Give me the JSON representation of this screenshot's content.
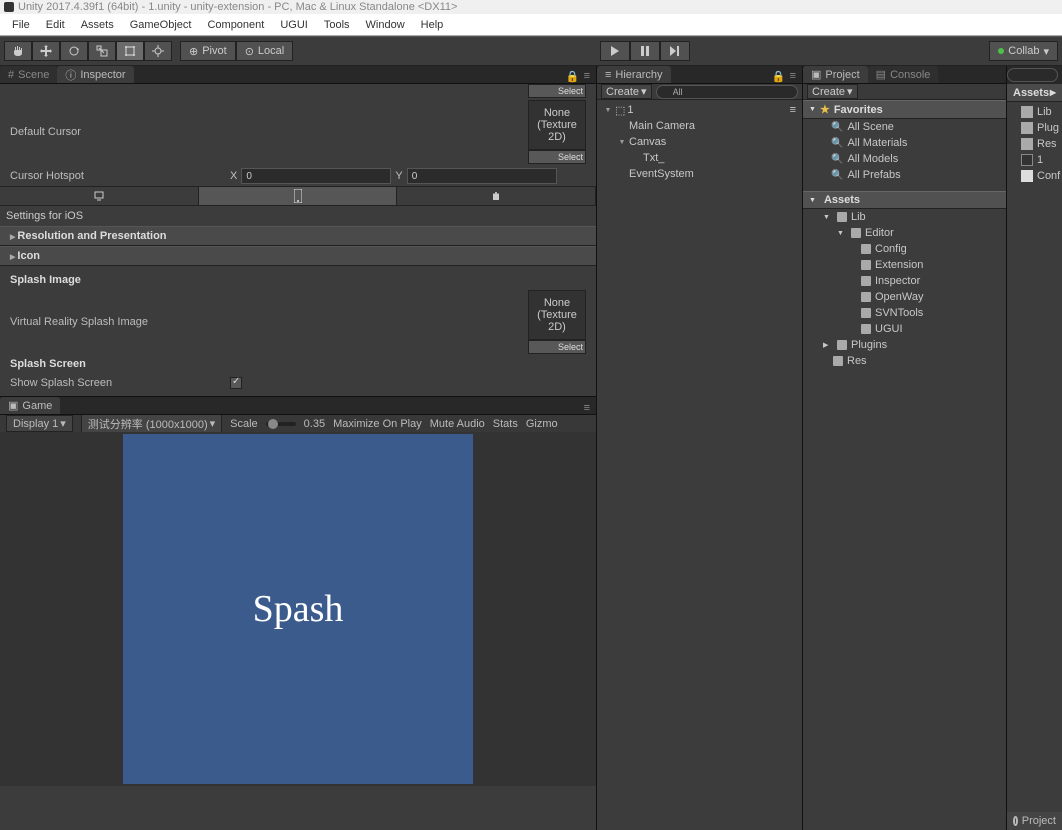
{
  "title": "Unity 2017.4.39f1 (64bit) - 1.unity - unity-extension - PC, Mac & Linux Standalone <DX11>",
  "menu": [
    "File",
    "Edit",
    "Assets",
    "GameObject",
    "Component",
    "UGUI",
    "Tools",
    "Window",
    "Help"
  ],
  "toolbar": {
    "pivot": "Pivot",
    "local": "Local",
    "collab": "Collab"
  },
  "tabs": {
    "scene": "Scene",
    "inspector": "Inspector",
    "hierarchy": "Hierarchy",
    "project": "Project",
    "console": "Console",
    "game": "Game"
  },
  "inspector": {
    "defaultCursor": "Default Cursor",
    "cursorHotspot": "Cursor Hotspot",
    "hotspotX": "0",
    "hotspotY": "0",
    "none": "None",
    "texture2d": "(Texture 2D)",
    "select": "Select",
    "settingsFor": "Settings for iOS",
    "resPres": "Resolution and Presentation",
    "icon": "Icon",
    "splashImage": "Splash Image",
    "vrSplash": "Virtual Reality Splash Image",
    "splashScreen": "Splash Screen",
    "showSplash": "Show Splash Screen"
  },
  "game": {
    "display": "Display 1",
    "res": "测试分辨率 (1000x1000)",
    "scale": "Scale",
    "scaleVal": "0.35",
    "maximize": "Maximize On Play",
    "mute": "Mute Audio",
    "stats": "Stats",
    "gizmos": "Gizmo",
    "splashText": "Spash"
  },
  "hierarchy": {
    "create": "Create",
    "searchPlaceholder": "All",
    "scene": "1",
    "items": [
      "Main Camera",
      "Canvas",
      "Txt_",
      "EventSystem"
    ]
  },
  "project": {
    "create": "Create",
    "favorites": "Favorites",
    "favItems": [
      "All Scene",
      "All Materials",
      "All Models",
      "All Prefabs"
    ],
    "assets": "Assets",
    "tree": {
      "lib": "Lib",
      "editor": "Editor",
      "editorItems": [
        "Config",
        "Extension",
        "Inspector",
        "OpenWay",
        "SVNTools",
        "UGUI"
      ],
      "plugins": "Plugins",
      "res": "Res"
    }
  },
  "assetsPane": {
    "head": "Assets",
    "items": [
      "Lib",
      "Plug",
      "Res",
      "1",
      "Conf"
    ],
    "footer": "Project"
  },
  "glyph": {
    "x": "X",
    "y": "Y",
    "magnify": "🔍",
    "dd": "▾",
    "opt": "▤",
    "lock": "🔒",
    "menu": "≡"
  }
}
